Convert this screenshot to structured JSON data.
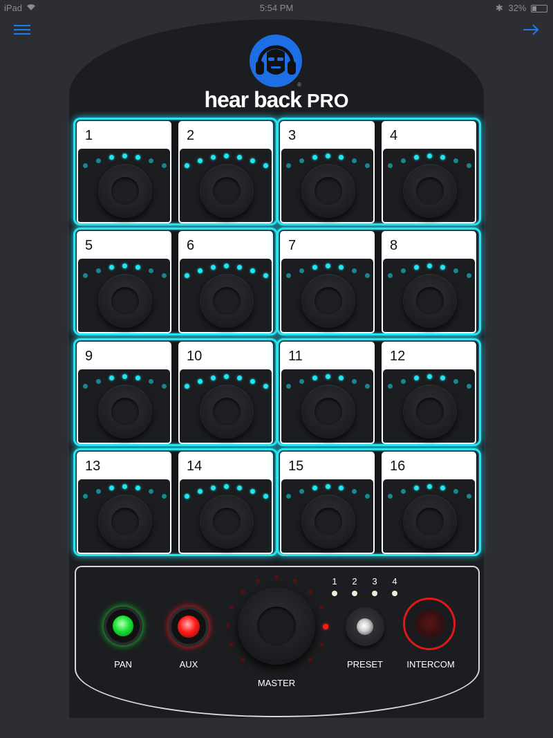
{
  "status_bar": {
    "device": "iPad",
    "time": "5:54 PM",
    "battery": "32%",
    "battery_level": 0.32
  },
  "nav": {
    "menu_icon": "hamburger-menu-icon",
    "next_icon": "arrow-right-icon",
    "accent": "#1e7cf0"
  },
  "brand": {
    "name": "hear back",
    "suffix": "PRO",
    "registered": "®",
    "logo_color": "#1e6ee6"
  },
  "channels": [
    {
      "label": "1",
      "level": 3
    },
    {
      "label": "2",
      "level": 6
    },
    {
      "label": "3",
      "level": 3
    },
    {
      "label": "4",
      "level": 4
    },
    {
      "label": "5",
      "level": 3
    },
    {
      "label": "6",
      "level": 6
    },
    {
      "label": "7",
      "level": 3
    },
    {
      "label": "8",
      "level": 4
    },
    {
      "label": "9",
      "level": 3
    },
    {
      "label": "10",
      "level": 6
    },
    {
      "label": "11",
      "level": 3
    },
    {
      "label": "12",
      "level": 4
    },
    {
      "label": "13",
      "level": 3
    },
    {
      "label": "14",
      "level": 6
    },
    {
      "label": "15",
      "level": 3
    },
    {
      "label": "16",
      "level": 4
    }
  ],
  "colors": {
    "group_glow": "#2be4f2",
    "led_on": "#20e8f0",
    "led_dim": "#17888f"
  },
  "master_section": {
    "pan_label": "PAN",
    "pan_color": "#19e135",
    "aux_label": "AUX",
    "aux_color": "#ff1a1a",
    "master_label": "MASTER",
    "master_level": 0.8,
    "preset_label": "PRESET",
    "preset_numbers": [
      "1",
      "2",
      "3",
      "4"
    ],
    "intercom_label": "INTERCOM",
    "intercom_color": "#e01818"
  }
}
